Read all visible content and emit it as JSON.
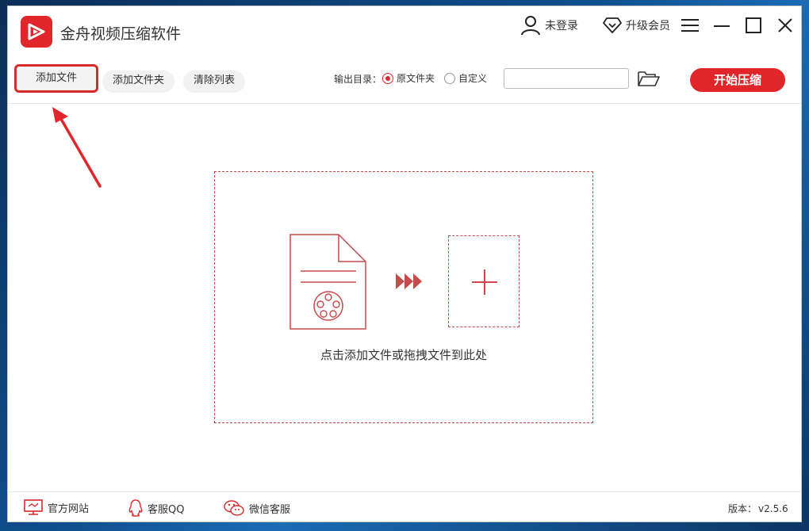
{
  "app": {
    "title": "金舟视频压缩软件"
  },
  "titlebar": {
    "login_label": "未登录",
    "upgrade_label": "升级会员"
  },
  "toolbar": {
    "add_file": "添加文件",
    "add_folder": "添加文件夹",
    "clear_list": "清除列表",
    "output_label": "输出目录：",
    "output_options": [
      {
        "label": "原文件夹",
        "checked": true
      },
      {
        "label": "自定义",
        "checked": false
      }
    ],
    "path_value": "",
    "start_button": "开始压缩"
  },
  "dropzone": {
    "hint": "点击添加文件或拖拽文件到此处"
  },
  "footer": {
    "website": "官方网站",
    "qq": "客服QQ",
    "wechat": "微信客服",
    "version_label": "版本：",
    "version_value": "v2.5.6"
  },
  "colors": {
    "accent": "#e0262a",
    "dash": "#c84a4a"
  }
}
